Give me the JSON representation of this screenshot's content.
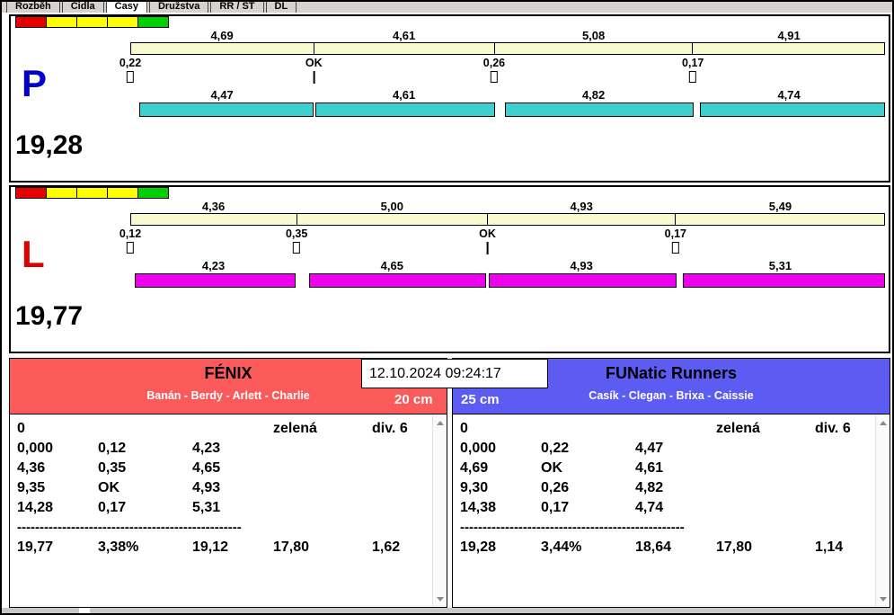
{
  "tabs": {
    "items": [
      {
        "label": "Rozběh",
        "selected": false
      },
      {
        "label": "Čidla",
        "selected": false
      },
      {
        "label": "Časy",
        "selected": true
      },
      {
        "label": "Družstva",
        "selected": false
      },
      {
        "label": "RR / ST",
        "selected": false
      },
      {
        "label": "DL",
        "selected": false
      }
    ]
  },
  "lanes": [
    {
      "letter": "P",
      "letter_color": "#0000c8",
      "total_time": "19,28",
      "bar_color": "#3ecfcf",
      "splits_top": [
        "4,69",
        "4,61",
        "5,08",
        "4,91"
      ],
      "crossings": [
        "0,22",
        "OK",
        "0,26",
        "0,17"
      ],
      "splits_bottom": [
        "4,47",
        "4,61",
        "4,82",
        "4,74"
      ]
    },
    {
      "letter": "L",
      "letter_color": "#dc0000",
      "total_time": "19,77",
      "bar_color": "#ee00ee",
      "splits_top": [
        "4,36",
        "5,00",
        "4,93",
        "5,49"
      ],
      "crossings": [
        "0,12",
        "0,35",
        "OK",
        "0,17"
      ],
      "splits_bottom": [
        "4,23",
        "4,65",
        "4,93",
        "5,31"
      ]
    }
  ],
  "timestamp": "12.10.2024 09:24:17",
  "teams": [
    {
      "name": "FÉNIX",
      "dogs": "Banán - Berdy - Arlett - Charlie",
      "height": "20 cm",
      "accent": "#fa5a5a",
      "start": {
        "zero": "0",
        "status": "zelená",
        "division": "div. 6"
      },
      "rows": [
        [
          "0,000",
          "0,12",
          "4,23"
        ],
        [
          "4,36",
          "0,35",
          "4,65"
        ],
        [
          "9,35",
          "OK",
          "4,93"
        ],
        [
          "14,28",
          "0,17",
          "5,31"
        ]
      ],
      "separator": "--------------------------------------------------",
      "totals": [
        "19,77",
        "3,38%",
        "19,12",
        "17,80",
        "1,62"
      ]
    },
    {
      "name": "FUNatic Runners",
      "dogs": "Casík - Clegan - Brixa - Caissie",
      "height": "25 cm",
      "accent": "#5c5cf2",
      "start": {
        "zero": "0",
        "status": "zelená",
        "division": "div. 6"
      },
      "rows": [
        [
          "0,000",
          "0,22",
          "4,47"
        ],
        [
          "4,69",
          "OK",
          "4,61"
        ],
        [
          "9,30",
          "0,26",
          "4,82"
        ],
        [
          "14,38",
          "0,17",
          "4,74"
        ]
      ],
      "separator": "--------------------------------------------------",
      "totals": [
        "19,28",
        "3,44%",
        "18,64",
        "17,80",
        "1,14"
      ]
    }
  ]
}
